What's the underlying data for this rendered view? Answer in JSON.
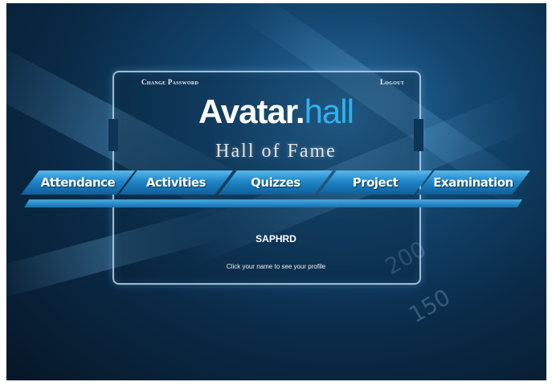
{
  "header": {
    "change_password": "Change Password",
    "logout": "Logout"
  },
  "logo": {
    "part1": "Avatar.",
    "part2": "hall"
  },
  "subtitle": "Hall of Fame",
  "nav": {
    "tabs": [
      {
        "label": "Attendance"
      },
      {
        "label": "Activities"
      },
      {
        "label": "Quizzes"
      },
      {
        "label": "Project"
      },
      {
        "label": "Examination"
      }
    ]
  },
  "main": {
    "username": "SAPHRD",
    "hint": "Click your name to see your profile"
  },
  "background": {
    "numbers": [
      "200",
      "150"
    ]
  },
  "colors": {
    "accent": "#2fb2ee",
    "tab_top": "#5ab8ea",
    "tab_bottom": "#0f5e99"
  }
}
